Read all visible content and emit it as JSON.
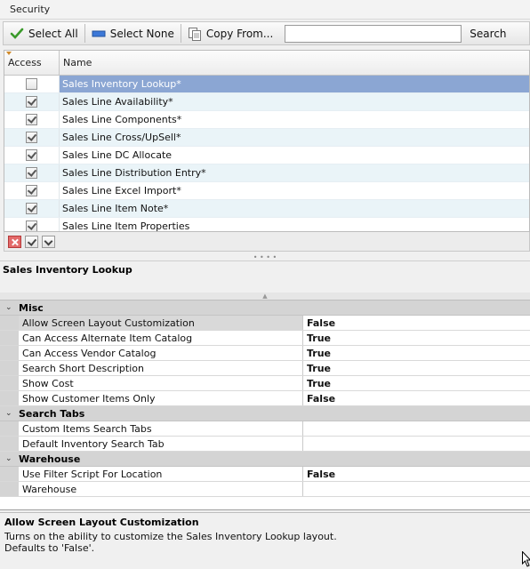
{
  "window": {
    "title": "Security"
  },
  "toolbar": {
    "select_all_label": "Select All",
    "select_none_label": "Select None",
    "copy_from_label": "Copy From...",
    "search_value": "",
    "search_label": "Search"
  },
  "grid": {
    "columns": {
      "access": "Access",
      "name": "Name"
    },
    "rows": [
      {
        "checked": false,
        "name": "Sales Inventory Lookup*"
      },
      {
        "checked": true,
        "name": "Sales Line Availability*"
      },
      {
        "checked": true,
        "name": "Sales Line Components*"
      },
      {
        "checked": true,
        "name": "Sales Line Cross/UpSell*"
      },
      {
        "checked": true,
        "name": "Sales Line DC Allocate"
      },
      {
        "checked": true,
        "name": "Sales Line Distribution Entry*"
      },
      {
        "checked": true,
        "name": "Sales Line Excel Import*"
      },
      {
        "checked": true,
        "name": "Sales Line Item Note*"
      },
      {
        "checked": true,
        "name": "Sales Line Item Properties"
      }
    ]
  },
  "selected_title": "Sales Inventory Lookup",
  "properties": {
    "categories": [
      {
        "name": "Misc",
        "items": [
          {
            "name": "Allow Screen Layout Customization",
            "value": "False"
          },
          {
            "name": "Can Access Alternate Item Catalog",
            "value": "True"
          },
          {
            "name": "Can Access Vendor Catalog",
            "value": "True"
          },
          {
            "name": "Search Short Description",
            "value": "True"
          },
          {
            "name": "Show Cost",
            "value": "True"
          },
          {
            "name": "Show Customer Items Only",
            "value": "False"
          }
        ]
      },
      {
        "name": "Search Tabs",
        "items": [
          {
            "name": "Custom Items Search Tabs",
            "value": ""
          },
          {
            "name": "Default Inventory Search Tab",
            "value": ""
          }
        ]
      },
      {
        "name": "Warehouse",
        "items": [
          {
            "name": "Use Filter Script For Location",
            "value": "False"
          },
          {
            "name": "Warehouse",
            "value": ""
          }
        ]
      }
    ]
  },
  "description": {
    "title": "Allow Screen Layout Customization",
    "line1": "Turns on the ability to customize the Sales Inventory Lookup layout.",
    "line2": "Defaults to 'False'."
  },
  "colors": {
    "selection": "#8ba6d3",
    "alt_row": "#eaf4f8",
    "category_bg": "#d4d4d4"
  }
}
